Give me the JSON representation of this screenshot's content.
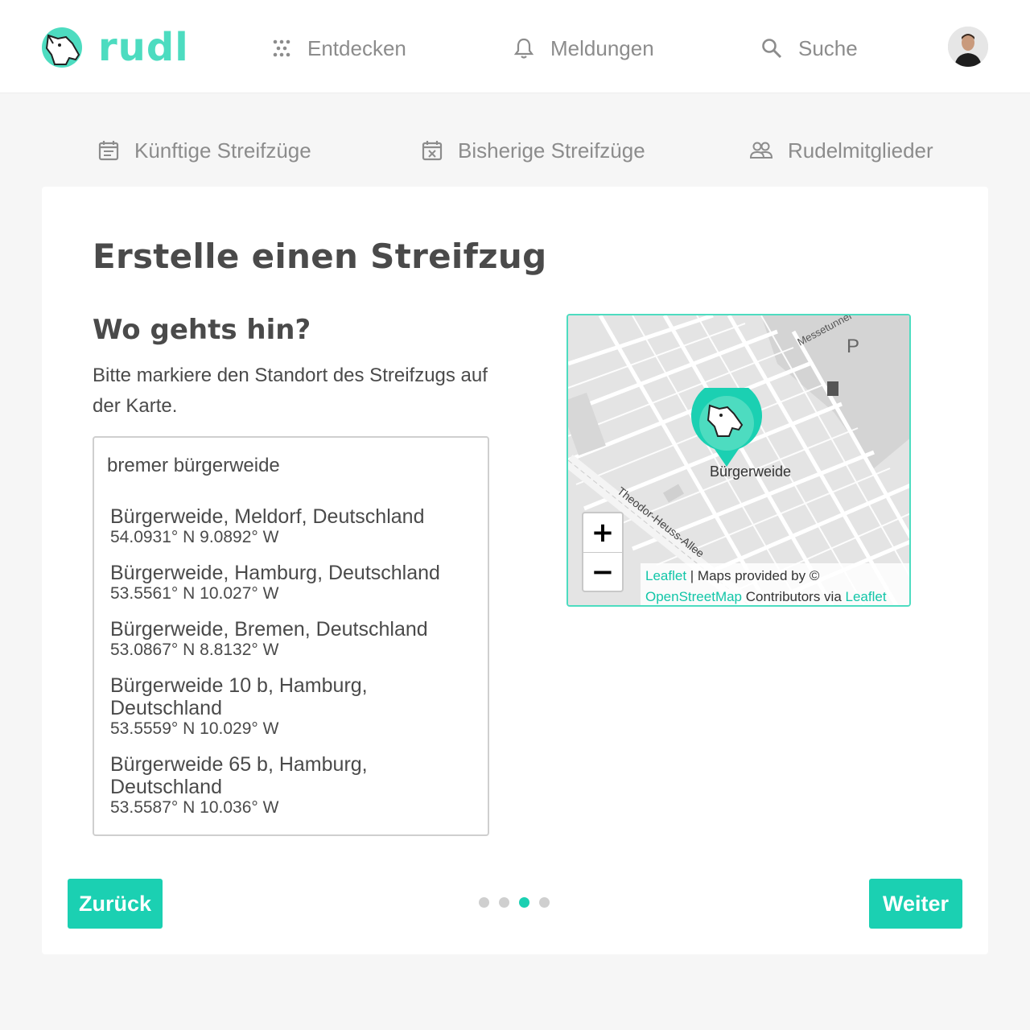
{
  "app": {
    "name": "rudl"
  },
  "nav": {
    "discover": "Entdecken",
    "notifications": "Meldungen",
    "search": "Suche"
  },
  "subnav": {
    "upcoming": "Künftige Streifzüge",
    "past": "Bisherige Streifzüge",
    "members": "Rudelmitglieder"
  },
  "page": {
    "title": "Erstelle einen Streifzug",
    "section_title": "Wo gehts hin?",
    "instructions": "Bitte markiere den Standort des Streifzugs auf der Karte."
  },
  "search": {
    "value": "bremer bürgerweide",
    "results": [
      {
        "name": "Bürgerweide, Meldorf, Deutschland",
        "coords": "54.0931° N 9.0892° W"
      },
      {
        "name": "Bürgerweide, Hamburg, Deutschland",
        "coords": "53.5561° N 10.027° W"
      },
      {
        "name": "Bürgerweide, Bremen, Deutschland",
        "coords": "53.0867° N 8.8132° W"
      },
      {
        "name": "Bürgerweide 10 b, Hamburg, Deutschland",
        "coords": "53.5559° N 10.029° W"
      },
      {
        "name": "Bürgerweide 65 b, Hamburg, Deutschland",
        "coords": "53.5587° N 10.036° W"
      }
    ]
  },
  "map": {
    "marker_label": "Bürgerweide",
    "street_label": "Theodor-Heuss-Allee",
    "area_label": "Messetunnel",
    "parking_label": "P",
    "zoom_in": "+",
    "zoom_out": "−",
    "attribution": {
      "leaflet": "Leaflet",
      "sep": " | Maps provided by © ",
      "osm": "OpenStreetMap",
      "via": " Contributors via ",
      "leaflet2": "Leaflet"
    }
  },
  "footer": {
    "back": "Zurück",
    "next": "Weiter",
    "steps_total": 4,
    "step_active": 3
  },
  "colors": {
    "accent": "#1bd0b2",
    "logo": "#4ddcc0",
    "muted": "#8c8c8c",
    "text": "#4a4a4a"
  }
}
